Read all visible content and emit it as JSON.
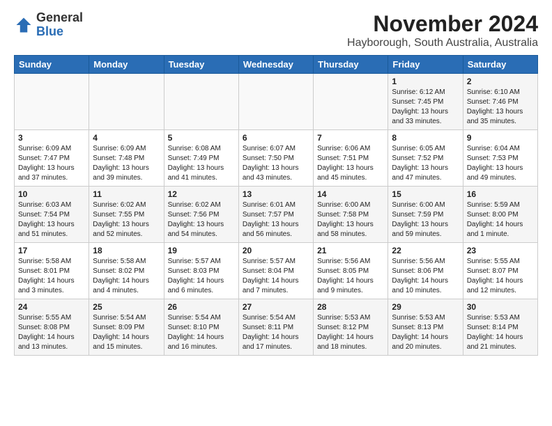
{
  "header": {
    "logo_general": "General",
    "logo_blue": "Blue",
    "title": "November 2024",
    "subtitle": "Hayborough, South Australia, Australia"
  },
  "weekdays": [
    "Sunday",
    "Monday",
    "Tuesday",
    "Wednesday",
    "Thursday",
    "Friday",
    "Saturday"
  ],
  "weeks": [
    [
      {
        "day": "",
        "info": ""
      },
      {
        "day": "",
        "info": ""
      },
      {
        "day": "",
        "info": ""
      },
      {
        "day": "",
        "info": ""
      },
      {
        "day": "",
        "info": ""
      },
      {
        "day": "1",
        "info": "Sunrise: 6:12 AM\nSunset: 7:45 PM\nDaylight: 13 hours\nand 33 minutes."
      },
      {
        "day": "2",
        "info": "Sunrise: 6:10 AM\nSunset: 7:46 PM\nDaylight: 13 hours\nand 35 minutes."
      }
    ],
    [
      {
        "day": "3",
        "info": "Sunrise: 6:09 AM\nSunset: 7:47 PM\nDaylight: 13 hours\nand 37 minutes."
      },
      {
        "day": "4",
        "info": "Sunrise: 6:09 AM\nSunset: 7:48 PM\nDaylight: 13 hours\nand 39 minutes."
      },
      {
        "day": "5",
        "info": "Sunrise: 6:08 AM\nSunset: 7:49 PM\nDaylight: 13 hours\nand 41 minutes."
      },
      {
        "day": "6",
        "info": "Sunrise: 6:07 AM\nSunset: 7:50 PM\nDaylight: 13 hours\nand 43 minutes."
      },
      {
        "day": "7",
        "info": "Sunrise: 6:06 AM\nSunset: 7:51 PM\nDaylight: 13 hours\nand 45 minutes."
      },
      {
        "day": "8",
        "info": "Sunrise: 6:05 AM\nSunset: 7:52 PM\nDaylight: 13 hours\nand 47 minutes."
      },
      {
        "day": "9",
        "info": "Sunrise: 6:04 AM\nSunset: 7:53 PM\nDaylight: 13 hours\nand 49 minutes."
      }
    ],
    [
      {
        "day": "10",
        "info": "Sunrise: 6:03 AM\nSunset: 7:54 PM\nDaylight: 13 hours\nand 51 minutes."
      },
      {
        "day": "11",
        "info": "Sunrise: 6:02 AM\nSunset: 7:55 PM\nDaylight: 13 hours\nand 52 minutes."
      },
      {
        "day": "12",
        "info": "Sunrise: 6:02 AM\nSunset: 7:56 PM\nDaylight: 13 hours\nand 54 minutes."
      },
      {
        "day": "13",
        "info": "Sunrise: 6:01 AM\nSunset: 7:57 PM\nDaylight: 13 hours\nand 56 minutes."
      },
      {
        "day": "14",
        "info": "Sunrise: 6:00 AM\nSunset: 7:58 PM\nDaylight: 13 hours\nand 58 minutes."
      },
      {
        "day": "15",
        "info": "Sunrise: 6:00 AM\nSunset: 7:59 PM\nDaylight: 13 hours\nand 59 minutes."
      },
      {
        "day": "16",
        "info": "Sunrise: 5:59 AM\nSunset: 8:00 PM\nDaylight: 14 hours\nand 1 minute."
      }
    ],
    [
      {
        "day": "17",
        "info": "Sunrise: 5:58 AM\nSunset: 8:01 PM\nDaylight: 14 hours\nand 3 minutes."
      },
      {
        "day": "18",
        "info": "Sunrise: 5:58 AM\nSunset: 8:02 PM\nDaylight: 14 hours\nand 4 minutes."
      },
      {
        "day": "19",
        "info": "Sunrise: 5:57 AM\nSunset: 8:03 PM\nDaylight: 14 hours\nand 6 minutes."
      },
      {
        "day": "20",
        "info": "Sunrise: 5:57 AM\nSunset: 8:04 PM\nDaylight: 14 hours\nand 7 minutes."
      },
      {
        "day": "21",
        "info": "Sunrise: 5:56 AM\nSunset: 8:05 PM\nDaylight: 14 hours\nand 9 minutes."
      },
      {
        "day": "22",
        "info": "Sunrise: 5:56 AM\nSunset: 8:06 PM\nDaylight: 14 hours\nand 10 minutes."
      },
      {
        "day": "23",
        "info": "Sunrise: 5:55 AM\nSunset: 8:07 PM\nDaylight: 14 hours\nand 12 minutes."
      }
    ],
    [
      {
        "day": "24",
        "info": "Sunrise: 5:55 AM\nSunset: 8:08 PM\nDaylight: 14 hours\nand 13 minutes."
      },
      {
        "day": "25",
        "info": "Sunrise: 5:54 AM\nSunset: 8:09 PM\nDaylight: 14 hours\nand 15 minutes."
      },
      {
        "day": "26",
        "info": "Sunrise: 5:54 AM\nSunset: 8:10 PM\nDaylight: 14 hours\nand 16 minutes."
      },
      {
        "day": "27",
        "info": "Sunrise: 5:54 AM\nSunset: 8:11 PM\nDaylight: 14 hours\nand 17 minutes."
      },
      {
        "day": "28",
        "info": "Sunrise: 5:53 AM\nSunset: 8:12 PM\nDaylight: 14 hours\nand 18 minutes."
      },
      {
        "day": "29",
        "info": "Sunrise: 5:53 AM\nSunset: 8:13 PM\nDaylight: 14 hours\nand 20 minutes."
      },
      {
        "day": "30",
        "info": "Sunrise: 5:53 AM\nSunset: 8:14 PM\nDaylight: 14 hours\nand 21 minutes."
      }
    ]
  ]
}
